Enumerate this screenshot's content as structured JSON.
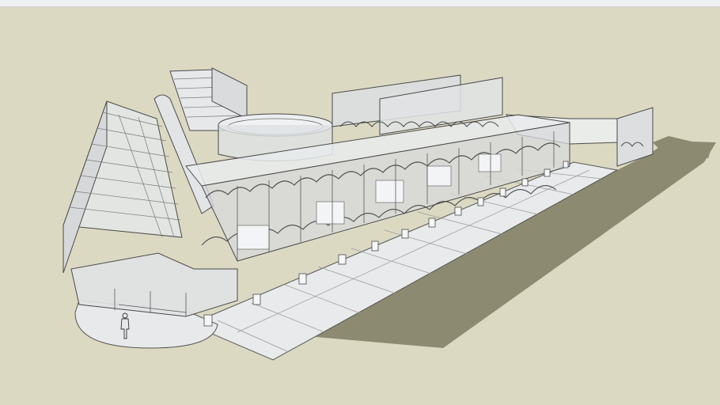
{
  "viewer": {
    "background_color": "#dcd9c3",
    "topbar_color": "#eef0f2",
    "shadow_color": "#8c8a70",
    "model_line_color": "#4a4a4a",
    "glass_color": "#e6e8ea"
  },
  "icons": {
    "scale_figure": "person-figure-icon"
  }
}
